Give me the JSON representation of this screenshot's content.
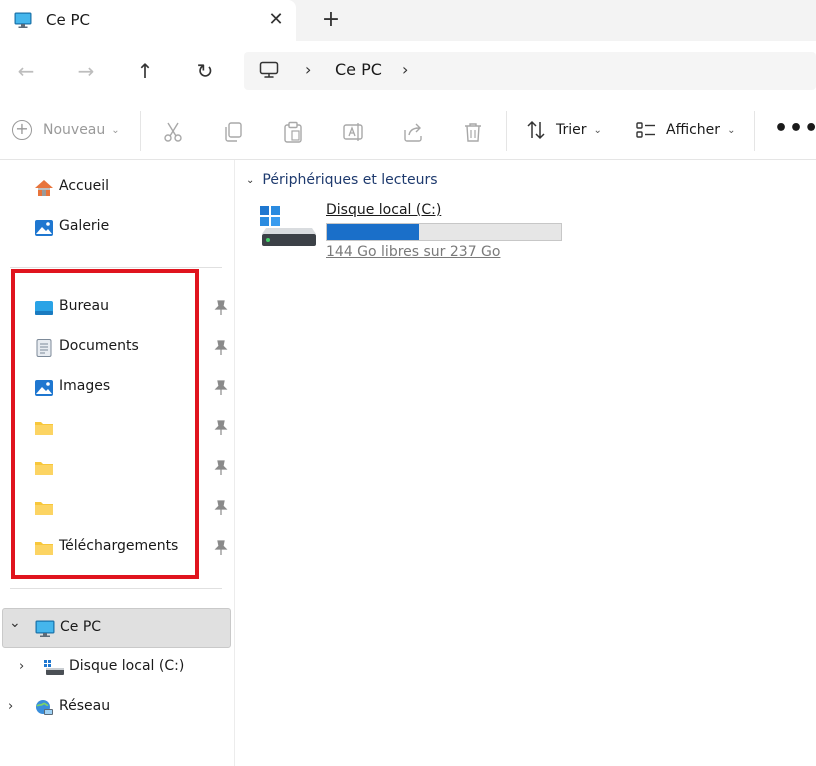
{
  "window": {
    "tab_title": "Ce PC",
    "close_glyph": "✕",
    "new_tab_glyph": "+"
  },
  "nav": {
    "back_glyph": "←",
    "forward_glyph": "→",
    "up_glyph": "↑",
    "refresh_glyph": "↻"
  },
  "address": {
    "chevron": "›",
    "location": "Ce PC"
  },
  "toolbar": {
    "new_label": "Nouveau",
    "new_plus": "+",
    "chevron": "⌄",
    "sort_label": "Trier",
    "view_label": "Afficher",
    "more_glyph": "•••",
    "icons": [
      "cut-icon",
      "copy-icon",
      "paste-icon",
      "rename-icon",
      "share-icon",
      "delete-icon",
      "sort-icon",
      "view-icon"
    ]
  },
  "sidebar": {
    "top_items": [
      {
        "label": "Accueil",
        "icon": "home-icon"
      },
      {
        "label": "Galerie",
        "icon": "gallery-icon"
      }
    ],
    "pinned_items": [
      {
        "label": "Bureau",
        "icon": "desktop-folder-icon",
        "pinned": true
      },
      {
        "label": "Documents",
        "icon": "documents-folder-icon",
        "pinned": true
      },
      {
        "label": "Images",
        "icon": "pictures-folder-icon",
        "pinned": true
      },
      {
        "label": "",
        "icon": "folder-icon",
        "pinned": true
      },
      {
        "label": "",
        "icon": "folder-icon",
        "pinned": true
      },
      {
        "label": "",
        "icon": "folder-icon",
        "pinned": true
      },
      {
        "label": "Téléchargements",
        "icon": "downloads-folder-icon",
        "pinned": true
      }
    ],
    "tree": {
      "this_pc": {
        "label": "Ce PC",
        "expanded": true,
        "selected": true
      },
      "local_disk": {
        "label": "Disque local (C:)",
        "expanded": false
      },
      "network": {
        "label": "Réseau",
        "expanded": false
      },
      "expanded_chevron": "⌄",
      "collapsed_chevron": "›"
    }
  },
  "main": {
    "group_label": "Périphériques et lecteurs",
    "group_chevron": "⌄",
    "drives": [
      {
        "name": "Disque local (C:)",
        "space_text": "144 Go libres sur 237 Go",
        "free_gb": 144,
        "total_gb": 237,
        "used_fraction": 0.392
      }
    ]
  },
  "colors": {
    "highlight_border": "#e0141e",
    "usage_bar": "#1a6fc9",
    "folder_yellow": "#f8c73a",
    "group_header": "#1e3a6e"
  }
}
